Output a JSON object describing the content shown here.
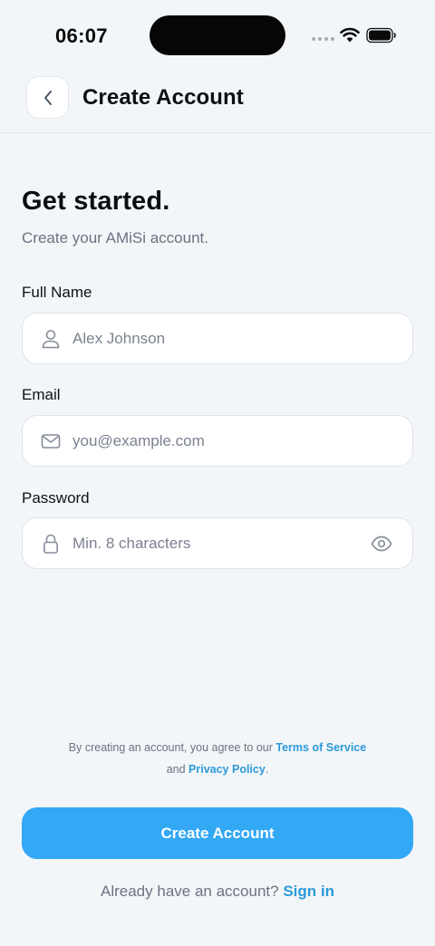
{
  "status_bar": {
    "time": "06:07"
  },
  "header": {
    "title": "Create Account"
  },
  "intro": {
    "heading": "Get started.",
    "subheading": "Create your AMiSi account."
  },
  "form": {
    "full_name": {
      "label": "Full Name",
      "placeholder": "Alex Johnson",
      "icon": "person-icon"
    },
    "email": {
      "label": "Email",
      "placeholder": "you@example.com",
      "icon": "mail-icon"
    },
    "password": {
      "label": "Password",
      "placeholder": "Min. 8 characters",
      "icon": "lock-icon",
      "toggle_icon": "eye-icon"
    }
  },
  "terms": {
    "prefix": "By creating an account, you agree to our",
    "terms_link": "Terms of Service",
    "conjunction": "and",
    "privacy_link": "Privacy Policy",
    "suffix": "."
  },
  "cta": {
    "label": "Create Account"
  },
  "signin": {
    "prompt": "Already have an account?",
    "link": "Sign in"
  },
  "colors": {
    "accent": "#33a8f5",
    "link": "#2c9ad8",
    "background": "#f3f6f9"
  }
}
